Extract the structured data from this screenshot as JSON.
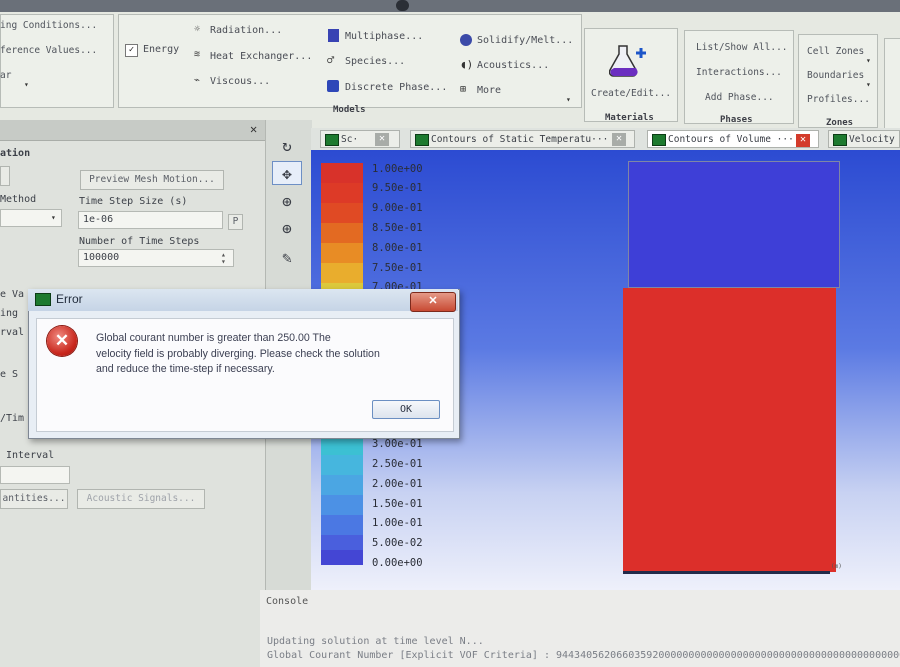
{
  "ribbon": {
    "tabs": [
      "",
      "",
      "",
      ""
    ],
    "setup": {
      "items": [
        "ing Conditions...",
        "ference Values...",
        "ar"
      ]
    },
    "models": {
      "energy_label": "Energy",
      "radiation": "Radiation...",
      "heat_exchanger": "Heat Exchanger...",
      "viscous": "Viscous...",
      "multiphase": "Multiphase...",
      "species": "Species...",
      "discrete_phase": "Discrete Phase...",
      "solidify": "Solidify/Melt...",
      "acoustics": "Acoustics...",
      "more": "More",
      "group_label": "Models"
    },
    "materials": {
      "create_edit": "Create/Edit...",
      "group_label": "Materials"
    },
    "phases": {
      "list_show": "List/Show All...",
      "interactions": "Interactions...",
      "add_phase": "Add Phase...",
      "group_label": "Phases"
    },
    "zones": {
      "cell_zones": "Cell Zones",
      "boundaries": "Boundaries",
      "profiles": "Profiles...",
      "group_label": "Zones"
    }
  },
  "left_panel": {
    "section_title": "ation",
    "preview_mesh_motion": "Preview Mesh Motion...",
    "method_label": "Method",
    "time_step_label": "Time Step Size (s)",
    "time_step_value": "1e-06",
    "p_button": "P",
    "num_steps_label": "Number of Time Steps",
    "num_steps_value": "100000",
    "frag_ve_va": "e Va",
    "frag_ing": "ing",
    "frag_rval": "rval",
    "frag_ve_s": "e S",
    "frag_tim": "/Tim",
    "interval_label": "Interval",
    "quantities_button": "antities...",
    "acoustic_signals_button": "Acoustic Signals..."
  },
  "graphics_tabs": [
    {
      "label": "Sc·"
    },
    {
      "label": "Contours of Static Temperatu···"
    },
    {
      "label": "Contours of Volume ···"
    },
    {
      "label": "Velocity"
    }
  ],
  "colorbar": {
    "labels": [
      "1.00e+00",
      "9.50e-01",
      "9.00e-01",
      "8.50e-01",
      "8.00e-01",
      "7.50e-01",
      "7.00e-01",
      "3.00e-01",
      "2.50e-01",
      "2.00e-01",
      "1.50e-01",
      "1.00e-01",
      "5.00e-02",
      "0.00e+00"
    ],
    "colors": {
      "c20": "#d8322a",
      "c19": "#dd3a27",
      "c18": "#e04a24",
      "c17": "#e36a22",
      "c16": "#e88c25",
      "c15": "#e9ad2d",
      "c14": "#dcc93b",
      "c13": "#bcd44a",
      "c6": "#3cc0d3",
      "c5": "#46b6de",
      "c4": "#4ba6e3",
      "c3": "#4c91e5",
      "c2": "#4b78e3",
      "c1": "#4a5fdd",
      "c0": "#4446d4"
    }
  },
  "domain_colors": {
    "top": "#3e3fd7",
    "bottom": "#dc2f2a"
  },
  "axis_tiny": "(m)",
  "dialog": {
    "title": "Error",
    "message_line1": "Global courant number is greater than 250.00   The",
    "message_line2": "velocity field is probably diverging. Please check the solution",
    "message_line3": "and reduce the time-step if necessary.",
    "ok": "OK"
  },
  "console": {
    "label": "Console",
    "line1": "Updating solution at time level N...",
    "line2": "Global Courant Number [Explicit VOF Criteria] : 94434056206603592000000000000000000000000000000000000000000000"
  }
}
